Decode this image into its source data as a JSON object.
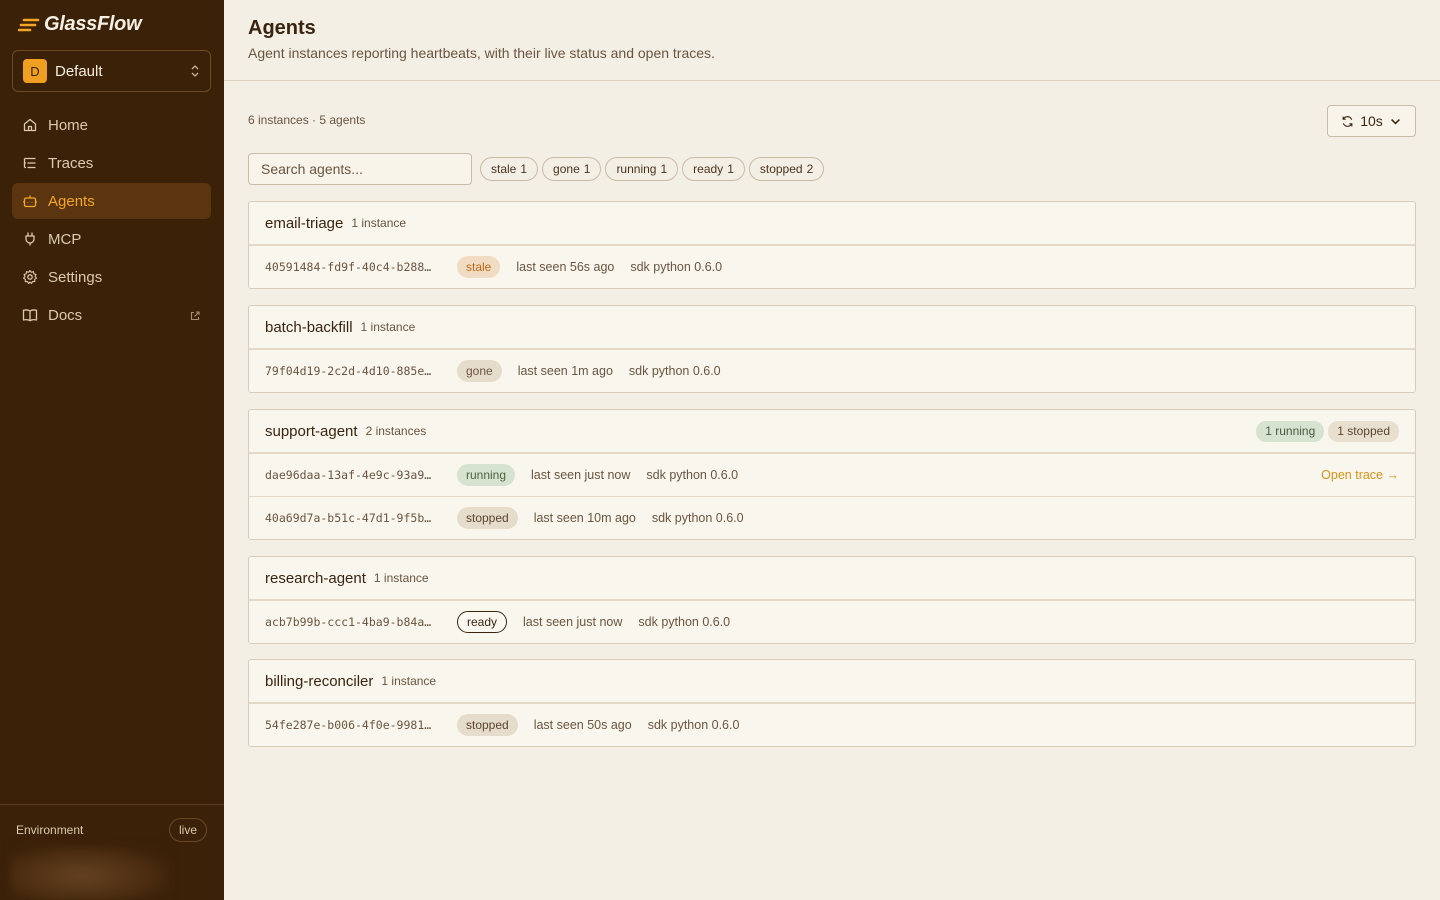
{
  "brand": {
    "name": "GlassFlow"
  },
  "workspace": {
    "initial": "D",
    "name": "Default"
  },
  "nav": [
    {
      "label": "Home",
      "icon": "home-icon",
      "active": false
    },
    {
      "label": "Traces",
      "icon": "list-icon",
      "active": false
    },
    {
      "label": "Agents",
      "icon": "bot-icon",
      "active": true
    },
    {
      "label": "MCP",
      "icon": "plug-icon",
      "active": false
    },
    {
      "label": "Settings",
      "icon": "gear-icon",
      "active": false
    },
    {
      "label": "Docs",
      "icon": "book-icon",
      "active": false,
      "external": true
    }
  ],
  "environment": {
    "label": "Environment",
    "value": "live"
  },
  "header": {
    "title": "Agents",
    "subtitle": "Agent instances reporting heartbeats, with their live status and open traces."
  },
  "summary": {
    "counts": "6 instances · 5 agents"
  },
  "refresh": {
    "interval": "10s"
  },
  "search": {
    "placeholder": "Search agents...",
    "value": ""
  },
  "filters": [
    {
      "label": "stale",
      "count": "1"
    },
    {
      "label": "gone",
      "count": "1"
    },
    {
      "label": "running",
      "count": "1"
    },
    {
      "label": "ready",
      "count": "1"
    },
    {
      "label": "stopped",
      "count": "2"
    }
  ],
  "agents": [
    {
      "name": "email-triage",
      "count": "1 instance",
      "summary": [],
      "instances": [
        {
          "id": "40591484-fd9f-40c4-b288…",
          "status": "stale",
          "last_seen": "last seen 56s ago",
          "sdk": "sdk python 0.6.0",
          "trace": ""
        }
      ]
    },
    {
      "name": "batch-backfill",
      "count": "1 instance",
      "summary": [],
      "instances": [
        {
          "id": "79f04d19-2c2d-4d10-885e…",
          "status": "gone",
          "last_seen": "last seen 1m ago",
          "sdk": "sdk python 0.6.0",
          "trace": ""
        }
      ]
    },
    {
      "name": "support-agent",
      "count": "2 instances",
      "summary": [
        {
          "label": "1 running",
          "kind": "running"
        },
        {
          "label": "1 stopped",
          "kind": "stopped"
        }
      ],
      "instances": [
        {
          "id": "dae96daa-13af-4e9c-93a9…",
          "status": "running",
          "last_seen": "last seen just now",
          "sdk": "sdk python 0.6.0",
          "trace": "Open trace →"
        },
        {
          "id": "40a69d7a-b51c-47d1-9f5b…",
          "status": "stopped",
          "last_seen": "last seen 10m ago",
          "sdk": "sdk python 0.6.0",
          "trace": ""
        }
      ]
    },
    {
      "name": "research-agent",
      "count": "1 instance",
      "summary": [],
      "instances": [
        {
          "id": "acb7b99b-ccc1-4ba9-b84a…",
          "status": "ready",
          "last_seen": "last seen just now",
          "sdk": "sdk python 0.6.0",
          "trace": ""
        }
      ]
    },
    {
      "name": "billing-reconciler",
      "count": "1 instance",
      "summary": [],
      "instances": [
        {
          "id": "54fe287e-b006-4f0e-9981…",
          "status": "stopped",
          "last_seen": "last seen 50s ago",
          "sdk": "sdk python 0.6.0",
          "trace": ""
        }
      ]
    }
  ],
  "colors": {
    "sidebar_bg": "#3b2107",
    "accent": "#f5a623",
    "page_bg": "#f3efe4",
    "link": "#d4921a"
  }
}
